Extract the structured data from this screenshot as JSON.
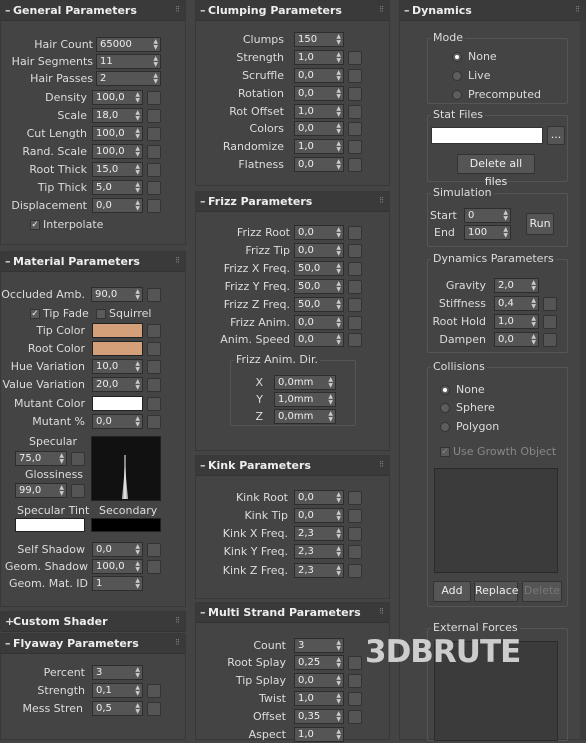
{
  "general": {
    "sign": "–",
    "title": "General Parameters",
    "grip": "⁝⁝",
    "hair_count": {
      "label": "Hair Count",
      "value": "65000"
    },
    "hair_segments": {
      "label": "Hair Segments",
      "value": "11"
    },
    "hair_passes": {
      "label": "Hair Passes",
      "value": "2"
    },
    "density": {
      "label": "Density",
      "value": "100,0"
    },
    "scale": {
      "label": "Scale",
      "value": "18,0"
    },
    "cut_length": {
      "label": "Cut Length",
      "value": "100,0"
    },
    "rand_scale": {
      "label": "Rand. Scale",
      "value": "100,0"
    },
    "root_thick": {
      "label": "Root Thick",
      "value": "15,0"
    },
    "tip_thick": {
      "label": "Tip Thick",
      "value": "5,0"
    },
    "displacement": {
      "label": "Displacement",
      "value": "0,0"
    },
    "interpolate": {
      "label": "Interpolate",
      "checked": "✓"
    }
  },
  "material": {
    "sign": "–",
    "title": "Material Parameters",
    "grip": "⁝⁝",
    "occluded_amb": {
      "label": "Occluded Amb.",
      "value": "90,0"
    },
    "tip_fade": {
      "label": "Tip Fade",
      "checked": "✓"
    },
    "squirrel": {
      "label": "Squirrel",
      "checked": ""
    },
    "tip_color": {
      "label": "Tip Color",
      "color": "#d4a07a"
    },
    "root_color": {
      "label": "Root Color",
      "color": "#d4a07a"
    },
    "hue_variation": {
      "label": "Hue Variation",
      "value": "10,0"
    },
    "value_variation": {
      "label": "Value Variation",
      "value": "20,0"
    },
    "mutant_color": {
      "label": "Mutant Color",
      "color": "#ffffff"
    },
    "mutant_pct": {
      "label": "Mutant %",
      "value": "0,0"
    },
    "specular": {
      "label": "Specular",
      "value": "75,0"
    },
    "glossiness": {
      "label": "Glossiness",
      "value": "99,0"
    },
    "specular_tint": {
      "label": "Specular Tint",
      "color": "#ffffff"
    },
    "secondary": {
      "label": "Secondary",
      "color": "#000000"
    },
    "self_shadow": {
      "label": "Self Shadow",
      "value": "0,0"
    },
    "geom_shadow": {
      "label": "Geom. Shadow",
      "value": "100,0"
    },
    "geom_mat_id": {
      "label": "Geom. Mat. ID",
      "value": "1"
    }
  },
  "custom_shader": {
    "sign": "+",
    "title": "Custom Shader",
    "grip": "⁝⁝"
  },
  "flyaway": {
    "sign": "–",
    "title": "Flyaway Parameters",
    "grip": "⁝⁝",
    "percent": {
      "label": "Percent",
      "value": "3"
    },
    "strength": {
      "label": "Strength",
      "value": "0,1"
    },
    "mess_stren": {
      "label": "Mess Stren",
      "value": "0,5"
    }
  },
  "clumping": {
    "sign": "–",
    "title": "Clumping Parameters",
    "grip": "⁝⁝",
    "clumps": {
      "label": "Clumps",
      "value": "150"
    },
    "strength": {
      "label": "Strength",
      "value": "1,0"
    },
    "scruffle": {
      "label": "Scruffle",
      "value": "0,0"
    },
    "rotation": {
      "label": "Rotation",
      "value": "0,0"
    },
    "rot_offset": {
      "label": "Rot Offset",
      "value": "1,0"
    },
    "colors": {
      "label": "Colors",
      "value": "0,0"
    },
    "randomize": {
      "label": "Randomize",
      "value": "1,0"
    },
    "flatness": {
      "label": "Flatness",
      "value": "0,0"
    }
  },
  "frizz": {
    "sign": "–",
    "title": "Frizz Parameters",
    "grip": "⁝⁝",
    "frizz_root": {
      "label": "Frizz Root",
      "value": "0,0"
    },
    "frizz_tip": {
      "label": "Frizz Tip",
      "value": "0,0"
    },
    "frizz_x": {
      "label": "Frizz X Freq.",
      "value": "50,0"
    },
    "frizz_y": {
      "label": "Frizz Y Freq.",
      "value": "50,0"
    },
    "frizz_z": {
      "label": "Frizz Z Freq.",
      "value": "50,0"
    },
    "frizz_anim": {
      "label": "Frizz Anim.",
      "value": "0,0"
    },
    "anim_speed": {
      "label": "Anim. Speed",
      "value": "0,0"
    },
    "anim_dir_title": "Frizz Anim. Dir.",
    "dir_x": {
      "label": "X",
      "value": "0,0mm"
    },
    "dir_y": {
      "label": "Y",
      "value": "1,0mm"
    },
    "dir_z": {
      "label": "Z",
      "value": "0,0mm"
    }
  },
  "kink": {
    "sign": "–",
    "title": "Kink Parameters",
    "grip": "⁝⁝",
    "kink_root": {
      "label": "Kink Root",
      "value": "0,0"
    },
    "kink_tip": {
      "label": "Kink Tip",
      "value": "0,0"
    },
    "kink_x": {
      "label": "Kink X Freq.",
      "value": "2,3"
    },
    "kink_y": {
      "label": "Kink Y Freq.",
      "value": "2,3"
    },
    "kink_z": {
      "label": "Kink Z Freq.",
      "value": "2,3"
    }
  },
  "multi_strand": {
    "sign": "–",
    "title": "Multi Strand Parameters",
    "grip": "⁝⁝",
    "count": {
      "label": "Count",
      "value": "3"
    },
    "root_splay": {
      "label": "Root Splay",
      "value": "0,25"
    },
    "tip_splay": {
      "label": "Tip Splay",
      "value": "0,0"
    },
    "twist": {
      "label": "Twist",
      "value": "1,0"
    },
    "offset": {
      "label": "Offset",
      "value": "0,35"
    },
    "aspect": {
      "label": "Aspect",
      "value": "1,0"
    }
  },
  "dynamics": {
    "sign": "–",
    "title": "Dynamics",
    "grip": "⁝⁝",
    "mode_title": "Mode",
    "mode_none": "None",
    "mode_live": "Live",
    "mode_precomputed": "Precomputed",
    "stat_files_title": "Stat Files",
    "browse": "...",
    "delete_all": "Delete all files",
    "simulation_title": "Simulation",
    "start": {
      "label": "Start",
      "value": "0"
    },
    "end": {
      "label": "End",
      "value": "100"
    },
    "run": "Run",
    "dyn_params_title": "Dynamics Parameters",
    "gravity": {
      "label": "Gravity",
      "value": "2,0"
    },
    "stiffness": {
      "label": "Stiffness",
      "value": "0,4"
    },
    "root_hold": {
      "label": "Root Hold",
      "value": "1,0"
    },
    "dampen": {
      "label": "Dampen",
      "value": "0,0"
    },
    "collisions_title": "Collisions",
    "col_none": "None",
    "col_sphere": "Sphere",
    "col_polygon": "Polygon",
    "use_growth": "Use Growth Object",
    "add": "Add",
    "replace": "Replace",
    "delete": "Delete",
    "external_forces_title": "External Forces"
  },
  "watermark": "3DBRUTE",
  "colors": {
    "panel": "#444444",
    "field": "#555555",
    "accent_tip": "#d4a07a"
  }
}
